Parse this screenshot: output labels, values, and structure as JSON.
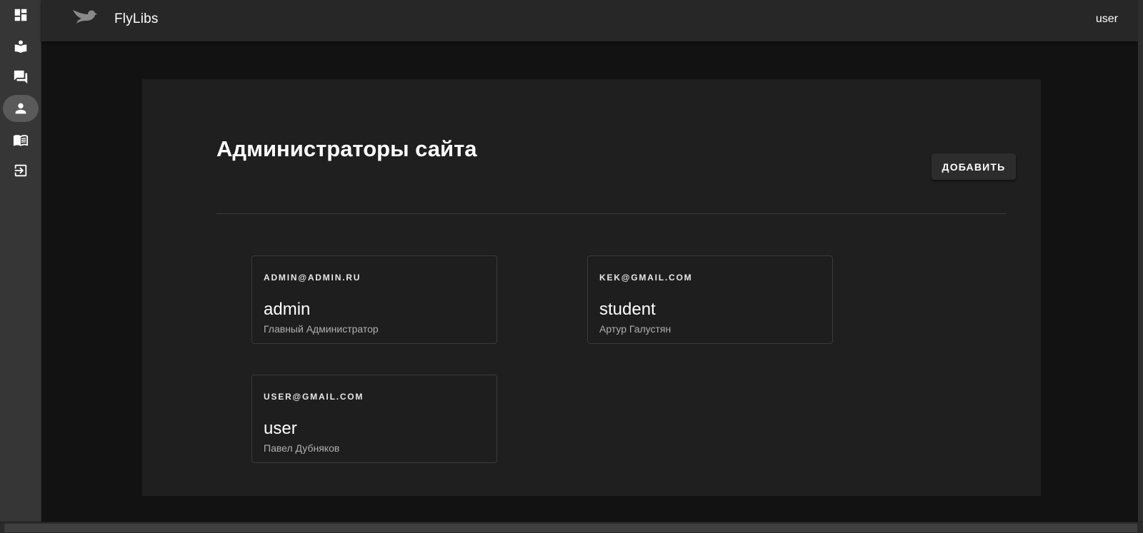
{
  "app": {
    "title": "FlyLibs",
    "user_label": "user"
  },
  "nav_rail": {
    "items": [
      {
        "icon": "dashboard-icon",
        "active": false
      },
      {
        "icon": "reader-icon",
        "active": false
      },
      {
        "icon": "forum-icon",
        "active": false
      },
      {
        "icon": "person-icon",
        "active": true
      },
      {
        "icon": "book-open-icon",
        "active": false
      },
      {
        "icon": "logout-icon",
        "active": false
      }
    ]
  },
  "page": {
    "title": "Администраторы сайта",
    "add_button_label": "ДОБАВИТЬ"
  },
  "admins": [
    {
      "email": "admin@admin.ru",
      "login": "admin",
      "full_name": "Главный Администратор"
    },
    {
      "email": "kek@gmail.com",
      "login": "student",
      "full_name": "Артур Галустян"
    },
    {
      "email": "user@gmail.com",
      "login": "user",
      "full_name": "Павел Дубняков"
    }
  ],
  "colors": {
    "background": "#121212",
    "surface": "#1f1f1f",
    "app_bar": "#272727",
    "nav_rail": "#363636",
    "active_nav": "#5a5a5a"
  }
}
